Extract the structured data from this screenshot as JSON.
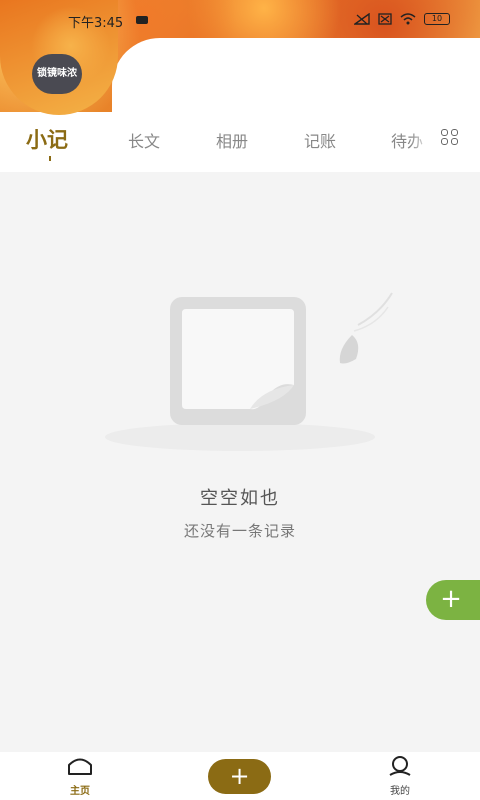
{
  "status_bar": {
    "time": "下午3:45",
    "battery": "10"
  },
  "profile": {
    "avatar_text": "锁镜味浓"
  },
  "tabs": [
    {
      "label": "小记",
      "active": true
    },
    {
      "label": "长文",
      "active": false
    },
    {
      "label": "相册",
      "active": false
    },
    {
      "label": "记账",
      "active": false
    },
    {
      "label": "待办",
      "active": false
    }
  ],
  "empty_state": {
    "title": "空空如也",
    "subtitle": "还没有一条记录"
  },
  "fab": {
    "label": "+"
  },
  "bottom_nav": {
    "home_label": "主页",
    "add_label": "+",
    "mine_label": "我的"
  },
  "colors": {
    "accent": "#8b6b14",
    "fab": "#7cb342",
    "background": "#f4f4f4"
  },
  "icons": [
    "home-icon",
    "user-icon",
    "grid-icon",
    "wifi-icon",
    "signal-icon",
    "battery-icon"
  ]
}
